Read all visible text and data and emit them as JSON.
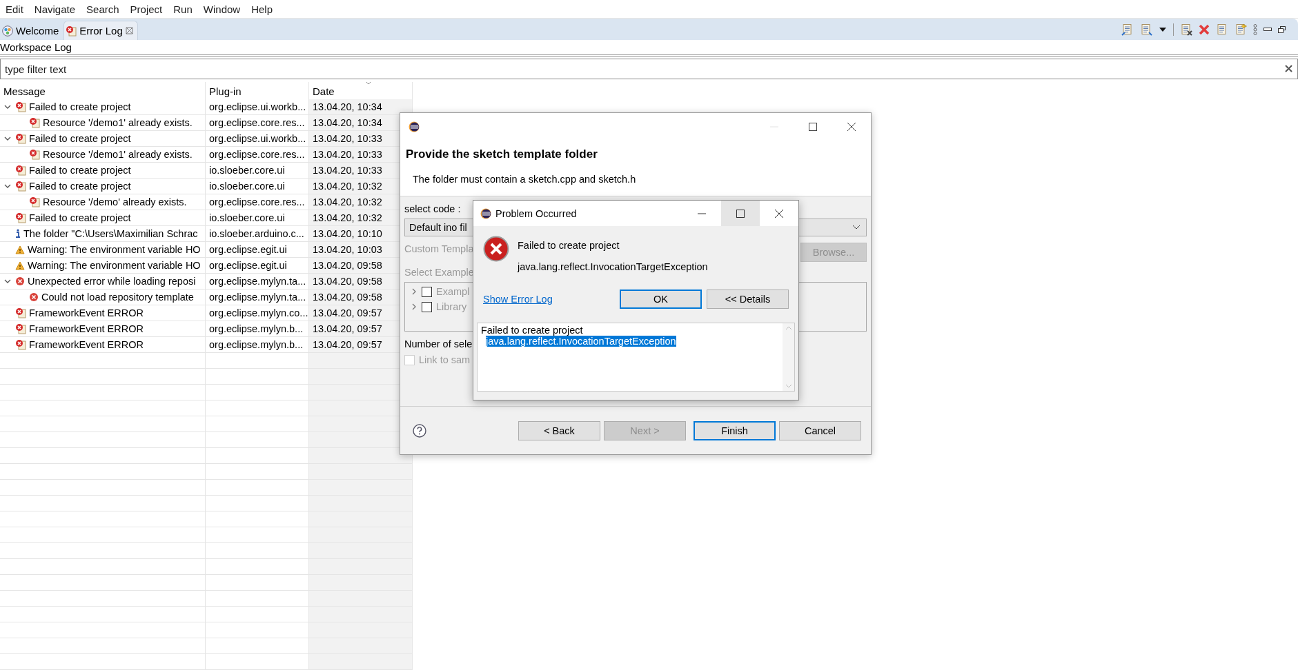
{
  "menu": [
    "Edit",
    "Navigate",
    "Search",
    "Project",
    "Run",
    "Window",
    "Help"
  ],
  "tabs": [
    {
      "label": "Welcome",
      "kind": "welcome",
      "selected": false
    },
    {
      "label": "Error Log",
      "kind": "errorlog",
      "selected": true
    }
  ],
  "view": {
    "title": "Workspace Log",
    "filter": {
      "placeholder": "type filter text"
    }
  },
  "table": {
    "columns": [
      {
        "label": "Message",
        "sorted": false
      },
      {
        "label": "Plug-in",
        "sorted": false
      },
      {
        "label": "Date",
        "sorted": true
      }
    ],
    "rows": [
      {
        "kind": "error-doc",
        "message": "Failed to create project",
        "plugin": "org.eclipse.ui.workb...",
        "date": "13.04.20, 10:34",
        "expanded": true,
        "children": [
          {
            "kind": "error-doc",
            "message": "Resource '/demo1' already exists.",
            "plugin": "org.eclipse.core.res...",
            "date": "13.04.20, 10:34"
          }
        ]
      },
      {
        "kind": "error-doc",
        "message": "Failed to create project",
        "plugin": "org.eclipse.ui.workb...",
        "date": "13.04.20, 10:33",
        "expanded": true,
        "children": [
          {
            "kind": "error-doc",
            "message": "Resource '/demo1' already exists.",
            "plugin": "org.eclipse.core.res...",
            "date": "13.04.20, 10:33"
          }
        ]
      },
      {
        "kind": "error-doc",
        "message": "Failed to create project",
        "plugin": "io.sloeber.core.ui",
        "date": "13.04.20, 10:33"
      },
      {
        "kind": "error-doc",
        "message": "Failed to create project",
        "plugin": "io.sloeber.core.ui",
        "date": "13.04.20, 10:32",
        "expanded": true,
        "children": [
          {
            "kind": "error-doc",
            "message": "Resource '/demo' already exists.",
            "plugin": "org.eclipse.core.res...",
            "date": "13.04.20, 10:32"
          }
        ]
      },
      {
        "kind": "error-doc",
        "message": "Failed to create project",
        "plugin": "io.sloeber.core.ui",
        "date": "13.04.20, 10:32"
      },
      {
        "kind": "info",
        "message": "The folder \"C:\\Users\\Maximilian Schrac",
        "plugin": "io.sloeber.arduino.c...",
        "date": "13.04.20, 10:10"
      },
      {
        "kind": "warning",
        "message": "Warning: The environment variable HO",
        "plugin": "org.eclipse.egit.ui",
        "date": "13.04.20, 10:03"
      },
      {
        "kind": "warning",
        "message": "Warning: The environment variable HO",
        "plugin": "org.eclipse.egit.ui",
        "date": "13.04.20, 09:58"
      },
      {
        "kind": "error",
        "message": "Unexpected error while loading reposi",
        "plugin": "org.eclipse.mylyn.ta...",
        "date": "13.04.20, 09:58",
        "expanded": true,
        "children": [
          {
            "kind": "error",
            "message": "Could not load repository template",
            "plugin": "org.eclipse.mylyn.ta...",
            "date": "13.04.20, 09:58"
          }
        ]
      },
      {
        "kind": "error-doc",
        "message": "FrameworkEvent ERROR",
        "plugin": "org.eclipse.mylyn.co...",
        "date": "13.04.20, 09:57"
      },
      {
        "kind": "error-doc",
        "message": "FrameworkEvent ERROR",
        "plugin": "org.eclipse.mylyn.b...",
        "date": "13.04.20, 09:57"
      },
      {
        "kind": "error-doc",
        "message": "FrameworkEvent ERROR",
        "plugin": "org.eclipse.mylyn.b...",
        "date": "13.04.20, 09:57"
      }
    ]
  },
  "wizard": {
    "title": "Provide the sketch template folder",
    "description": "The folder must contain a sketch.cpp and sketch.h",
    "select_label": "select code :",
    "select_value": "Default ino fil",
    "custom_label": "Custom Templa",
    "browse": {
      "label": "Browse...",
      "disabled": true
    },
    "examples_label": "Select Example",
    "tree": [
      {
        "label": "Exampl",
        "checked": false
      },
      {
        "label": "Library",
        "checked": false
      }
    ],
    "count_label": "Number of sele",
    "link": {
      "label": "Link to sam",
      "checked": false,
      "disabled": true
    },
    "buttons": [
      {
        "label": "< Back",
        "disabled": false,
        "default": false
      },
      {
        "label": "Next >",
        "disabled": true,
        "default": false
      },
      {
        "label": "Finish",
        "disabled": false,
        "default": true
      },
      {
        "label": "Cancel",
        "disabled": false,
        "default": false
      }
    ]
  },
  "problem": {
    "title": "Problem Occurred",
    "message": "Failed to create project",
    "detail": "java.lang.reflect.InvocationTargetException",
    "link": "Show Error Log",
    "buttons": [
      {
        "label": "OK",
        "default": true
      },
      {
        "label": "<< Details",
        "default": false
      }
    ],
    "details": [
      {
        "text": "Failed to create project",
        "selected": false
      },
      {
        "text": "java.lang.reflect.InvocationTargetException",
        "selected": true
      }
    ]
  }
}
